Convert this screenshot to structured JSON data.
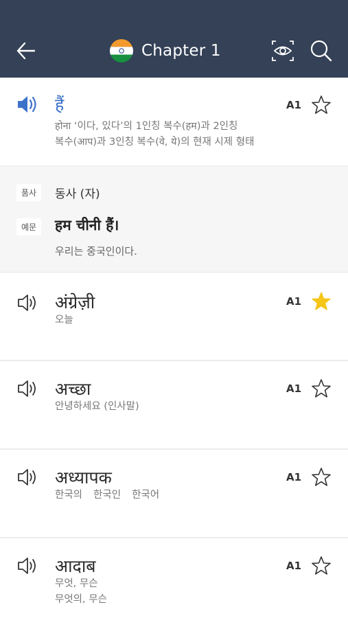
{
  "header": {
    "title": "Chapter 1",
    "flag": "india-flag-icon",
    "colors": {
      "background": "#344157",
      "accent": "#3d72c9",
      "star_filled": "#f5c518"
    }
  },
  "entries": [
    {
      "word": "हैं",
      "meaning_lines": [
        "होना ‘이다, 있다’의 1인칭 복수(हम)과 2인칭",
        "복수(आप)과 3인칭 복수(वे, ये)의 현재 시제 형태"
      ],
      "level": "A1",
      "starred": false,
      "playing": true
    },
    {
      "word": "अंग्रेज़ी",
      "meaning_lines": [
        "오늘"
      ],
      "level": "A1",
      "starred": true,
      "playing": false
    },
    {
      "word": "अच्छा",
      "meaning_lines": [
        "안녕하세요 (인사말)"
      ],
      "level": "A1",
      "starred": false,
      "playing": false
    },
    {
      "word": "अध्यापक",
      "meaning_parts": [
        "한국의",
        "한국인",
        "한국어"
      ],
      "level": "A1",
      "starred": false,
      "playing": false
    },
    {
      "word": "आदाब",
      "meaning_lines": [
        "무엇, 무슨",
        "무엇의, 무슨"
      ],
      "level": "A1",
      "starred": false,
      "playing": false
    }
  ],
  "detail": {
    "pos_tag": "품사",
    "pos_value": "동사 (자)",
    "example_tag": "예문",
    "example_sentence": "हम चीनी हैं।",
    "example_translation": "우리는 중국인이다."
  }
}
